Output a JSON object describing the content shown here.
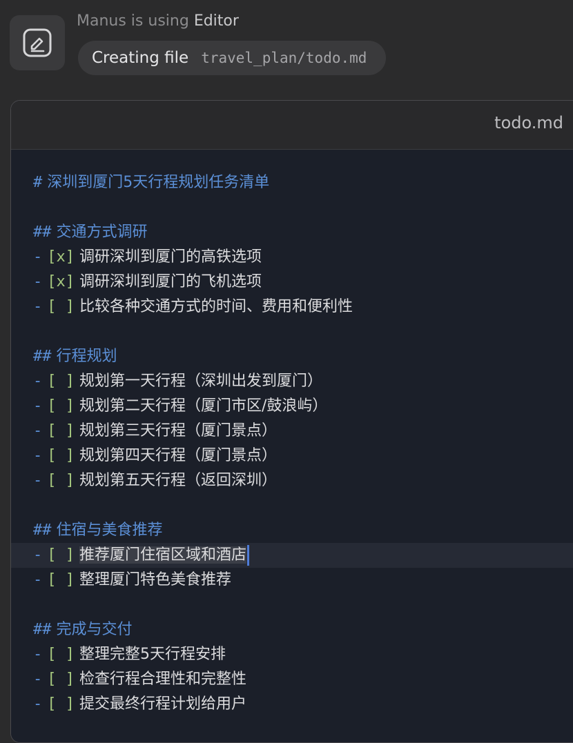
{
  "status": {
    "prefix": "Manus is using",
    "tool_name": "Editor",
    "action_label": "Creating file",
    "action_path": "travel_plan/todo.md",
    "tool_icon": "edit-icon"
  },
  "editor": {
    "filename": "todo.md",
    "lines": [
      {
        "kind": "h1",
        "marker": "#",
        "text": "深圳到厦门5天行程规划任务清单"
      },
      {
        "kind": "blank"
      },
      {
        "kind": "h2",
        "marker": "##",
        "text": "交通方式调研"
      },
      {
        "kind": "task",
        "dash": "-",
        "box": "[x]",
        "text": "调研深圳到厦门的高铁选项"
      },
      {
        "kind": "task",
        "dash": "-",
        "box": "[x]",
        "text": "调研深圳到厦门的飞机选项"
      },
      {
        "kind": "task",
        "dash": "-",
        "box": "[ ]",
        "text": "比较各种交通方式的时间、费用和便利性"
      },
      {
        "kind": "blank"
      },
      {
        "kind": "h2",
        "marker": "##",
        "text": "行程规划"
      },
      {
        "kind": "task",
        "dash": "-",
        "box": "[ ]",
        "text": "规划第一天行程（深圳出发到厦门）"
      },
      {
        "kind": "task",
        "dash": "-",
        "box": "[ ]",
        "text": "规划第二天行程（厦门市区/鼓浪屿）"
      },
      {
        "kind": "task",
        "dash": "-",
        "box": "[ ]",
        "text": "规划第三天行程（厦门景点）"
      },
      {
        "kind": "task",
        "dash": "-",
        "box": "[ ]",
        "text": "规划第四天行程（厦门景点）"
      },
      {
        "kind": "task",
        "dash": "-",
        "box": "[ ]",
        "text": "规划第五天行程（返回深圳）"
      },
      {
        "kind": "blank"
      },
      {
        "kind": "h2",
        "marker": "##",
        "text": "住宿与美食推荐"
      },
      {
        "kind": "task",
        "dash": "-",
        "box": "[ ]",
        "text": "推荐厦门住宿区域和酒店",
        "active": true
      },
      {
        "kind": "task",
        "dash": "-",
        "box": "[ ]",
        "text": "整理厦门特色美食推荐"
      },
      {
        "kind": "blank"
      },
      {
        "kind": "h2",
        "marker": "##",
        "text": "完成与交付"
      },
      {
        "kind": "task",
        "dash": "-",
        "box": "[ ]",
        "text": "整理完整5天行程安排"
      },
      {
        "kind": "task",
        "dash": "-",
        "box": "[ ]",
        "text": "检查行程合理性和完整性"
      },
      {
        "kind": "task",
        "dash": "-",
        "box": "[ ]",
        "text": "提交最终行程计划给用户"
      }
    ]
  }
}
